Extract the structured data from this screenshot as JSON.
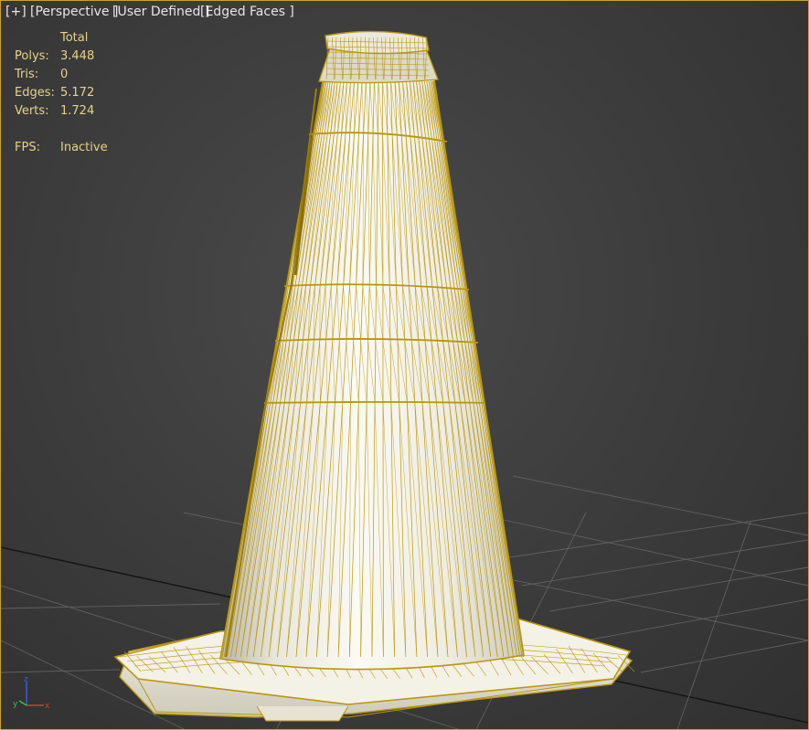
{
  "viewport": {
    "labels": [
      "[+]",
      "[Perspective ]",
      "[User Defined ]",
      "[Edged Faces ]"
    ],
    "stats": {
      "header": "Total",
      "rows": [
        {
          "key": "Polys:",
          "value": "3.448"
        },
        {
          "key": "Tris:",
          "value": "0"
        },
        {
          "key": "Edges:",
          "value": "5.172"
        },
        {
          "key": "Verts:",
          "value": "1.724"
        }
      ],
      "fps_key": "FPS:",
      "fps_value": "Inactive"
    },
    "axis_gizmo": {
      "z": "z",
      "y": "y",
      "x": "x"
    },
    "colors": {
      "wire": "#b8960f",
      "frame": "#c9a227",
      "stats_text": "#e8d38a",
      "axis_x": "#d23a3a",
      "axis_y": "#3fbf3f",
      "axis_z": "#3d5be0"
    }
  }
}
